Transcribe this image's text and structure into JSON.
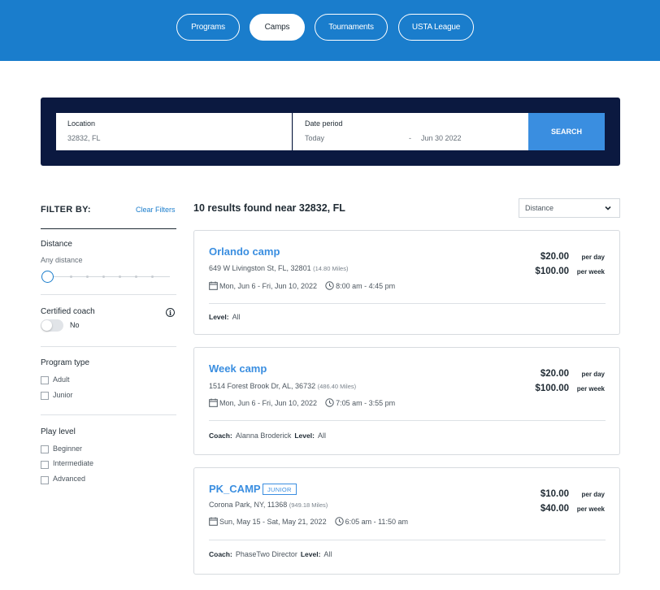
{
  "nav": {
    "tabs": [
      {
        "label": "Programs",
        "active": false
      },
      {
        "label": "Camps",
        "active": true
      },
      {
        "label": "Tournaments",
        "active": false
      },
      {
        "label": "USTA League",
        "active": false
      }
    ]
  },
  "search": {
    "location_label": "Location",
    "location_value": "32832, FL",
    "date_label": "Date period",
    "date_start": "Today",
    "date_separator": "-",
    "date_end": "Jun 30 2022",
    "button_label": "SEARCH"
  },
  "filters": {
    "title": "FILTER BY:",
    "clear_label": "Clear Filters",
    "distance": {
      "heading": "Distance",
      "value": "Any distance"
    },
    "certified_coach": {
      "heading": "Certified coach",
      "toggle_label": "No",
      "toggle_on": false
    },
    "program_type": {
      "heading": "Program type",
      "options": [
        "Adult",
        "Junior"
      ]
    },
    "play_level": {
      "heading": "Play level",
      "options": [
        "Beginner",
        "Intermediate",
        "Advanced"
      ]
    }
  },
  "results": {
    "count_text": "10 results found near 32832, FL",
    "sort_value": "Distance",
    "cards": [
      {
        "title": "Orlando camp",
        "badge": "",
        "address": "649 W Livingston St, FL, 32801",
        "miles": "(14.80 Miles)",
        "dates": "Mon, Jun 6 - Fri, Jun 10, 2022",
        "times": "8:00 am - 4:45 pm",
        "coach_label": "",
        "coach": "",
        "level_label": "Level:",
        "level": "All",
        "price_day": "$20.00",
        "price_day_unit": "per day",
        "price_week": "$100.00",
        "price_week_unit": "per week"
      },
      {
        "title": "Week camp",
        "badge": "",
        "address": "1514 Forest Brook Dr, AL, 36732",
        "miles": "(486.40 Miles)",
        "dates": "Mon, Jun 6 - Fri, Jun 10, 2022",
        "times": "7:05 am - 3:55 pm",
        "coach_label": "Coach:",
        "coach": "Alanna Broderick",
        "level_label": "Level:",
        "level": "All",
        "price_day": "$20.00",
        "price_day_unit": "per day",
        "price_week": "$100.00",
        "price_week_unit": "per week"
      },
      {
        "title": "PK_CAMP",
        "badge": "JUNIOR",
        "address": "Corona Park, NY, 11368",
        "miles": "(949.18 Miles)",
        "dates": "Sun, May 15 - Sat, May 21, 2022",
        "times": "6:05 am - 11:50 am",
        "coach_label": "Coach:",
        "coach": "PhaseTwo Director",
        "level_label": "Level:",
        "level": "All",
        "price_day": "$10.00",
        "price_day_unit": "per day",
        "price_week": "$40.00",
        "price_week_unit": "per week"
      }
    ]
  },
  "colors": {
    "header_blue": "#1a7dcc",
    "search_panel": "#0b1940",
    "accent_blue": "#3a8ee0"
  },
  "icons": [
    "calendar-icon",
    "clock-icon",
    "info-icon",
    "chevron-down-icon"
  ]
}
